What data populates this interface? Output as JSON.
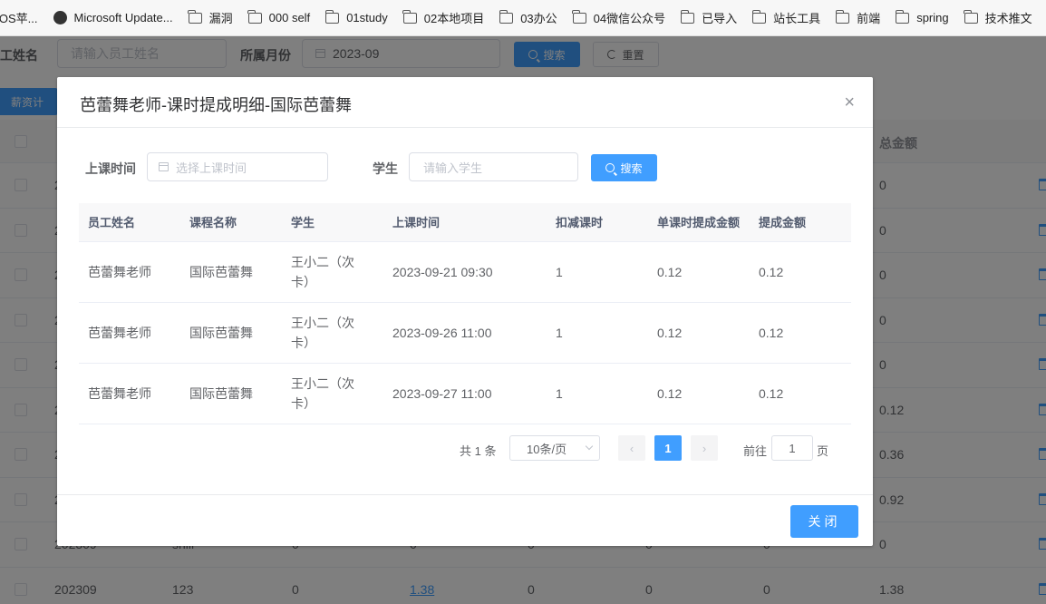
{
  "bookmarks": [
    {
      "label": "iOS苹...",
      "icon": "none"
    },
    {
      "label": "Microsoft Update...",
      "icon": "globe-icon"
    },
    {
      "label": "漏洞",
      "icon": "folder-icon"
    },
    {
      "label": "000 self",
      "icon": "folder-icon"
    },
    {
      "label": "01study",
      "icon": "folder-icon"
    },
    {
      "label": "02本地项目",
      "icon": "folder-icon"
    },
    {
      "label": "03办公",
      "icon": "folder-icon"
    },
    {
      "label": "04微信公众号",
      "icon": "folder-icon"
    },
    {
      "label": "已导入",
      "icon": "folder-icon"
    },
    {
      "label": "站长工具",
      "icon": "folder-icon"
    },
    {
      "label": "前端",
      "icon": "folder-icon"
    },
    {
      "label": "spring",
      "icon": "folder-icon"
    },
    {
      "label": "技术推文",
      "icon": "folder-icon"
    }
  ],
  "page": {
    "employee_label": "员工姓名",
    "employee_placeholder": "请输入员工姓名",
    "month_label": "所属月份",
    "month_value": "2023-09",
    "search_btn": "搜索",
    "reset_btn": "重置",
    "salary_btn": "薪资计",
    "total_header": "总金额",
    "rows": [
      {
        "c1": "2",
        "c2": "",
        "c3": "",
        "c4": "",
        "c5": "",
        "c6": "",
        "c7": "",
        "total": "0"
      },
      {
        "c1": "2",
        "c2": "",
        "c3": "",
        "c4": "",
        "c5": "",
        "c6": "",
        "c7": "",
        "total": "0"
      },
      {
        "c1": "2",
        "c2": "",
        "c3": "",
        "c4": "",
        "c5": "",
        "c6": "",
        "c7": "",
        "total": "0"
      },
      {
        "c1": "2",
        "c2": "",
        "c3": "",
        "c4": "",
        "c5": "",
        "c6": "",
        "c7": "",
        "total": "0"
      },
      {
        "c1": "2",
        "c2": "",
        "c3": "",
        "c4": "",
        "c5": "",
        "c6": "",
        "c7": "",
        "total": "0"
      },
      {
        "c1": "2",
        "c2": "",
        "c3": "",
        "c4": "",
        "c5": "",
        "c6": "",
        "c7": "",
        "total": "0.12"
      },
      {
        "c1": "2",
        "c2": "",
        "c3": "",
        "c4": "",
        "c5": "",
        "c6": "",
        "c7": "",
        "total": "0.36"
      },
      {
        "c1": "2",
        "c2": "",
        "c3": "",
        "c4": "",
        "c5": "",
        "c6": "",
        "c7": "",
        "total": "0.92"
      },
      {
        "c1": "202309",
        "c2": "shili",
        "c3": "0",
        "c4": "0",
        "c5": "0",
        "c6": "0",
        "c7": "0",
        "total": "0"
      },
      {
        "c1": "202309",
        "c2": "123",
        "c3": "0",
        "c4": "1.38",
        "c5": "0",
        "c6": "0",
        "c7": "0",
        "total": "1.38"
      }
    ]
  },
  "dialog": {
    "title": "芭蕾舞老师-课时提成明细-国际芭蕾舞",
    "close_glyph": "×",
    "filter": {
      "time_label": "上课时间",
      "time_placeholder": "选择上课时间",
      "student_label": "学生",
      "student_placeholder": "请输入学生",
      "search_btn": "搜索"
    },
    "columns": [
      "员工姓名",
      "课程名称",
      "学生",
      "上课时间",
      "扣减课时",
      "单课时提成金额",
      "提成金额"
    ],
    "rows": [
      {
        "employee": "芭蕾舞老师",
        "course": "国际芭蕾舞",
        "student": "王小二（次卡）",
        "time": "2023-09-21 09:30",
        "hours": "1",
        "unit": "0.12",
        "amount": "0.12"
      },
      {
        "employee": "芭蕾舞老师",
        "course": "国际芭蕾舞",
        "student": "王小二（次卡）",
        "time": "2023-09-26 11:00",
        "hours": "1",
        "unit": "0.12",
        "amount": "0.12"
      },
      {
        "employee": "芭蕾舞老师",
        "course": "国际芭蕾舞",
        "student": "王小二（次卡）",
        "time": "2023-09-27 11:00",
        "hours": "1",
        "unit": "0.12",
        "amount": "0.12"
      }
    ],
    "pager": {
      "total": "共 1 条",
      "page_size": "10条/页",
      "prev": "‹",
      "current": "1",
      "next": "›",
      "goto_label": "前往",
      "goto_value": "1",
      "page_suffix": "页"
    },
    "close_btn": "关闭"
  },
  "colors": {
    "primary": "#409eff",
    "mask": "rgba(0,0,0,0.5)"
  }
}
